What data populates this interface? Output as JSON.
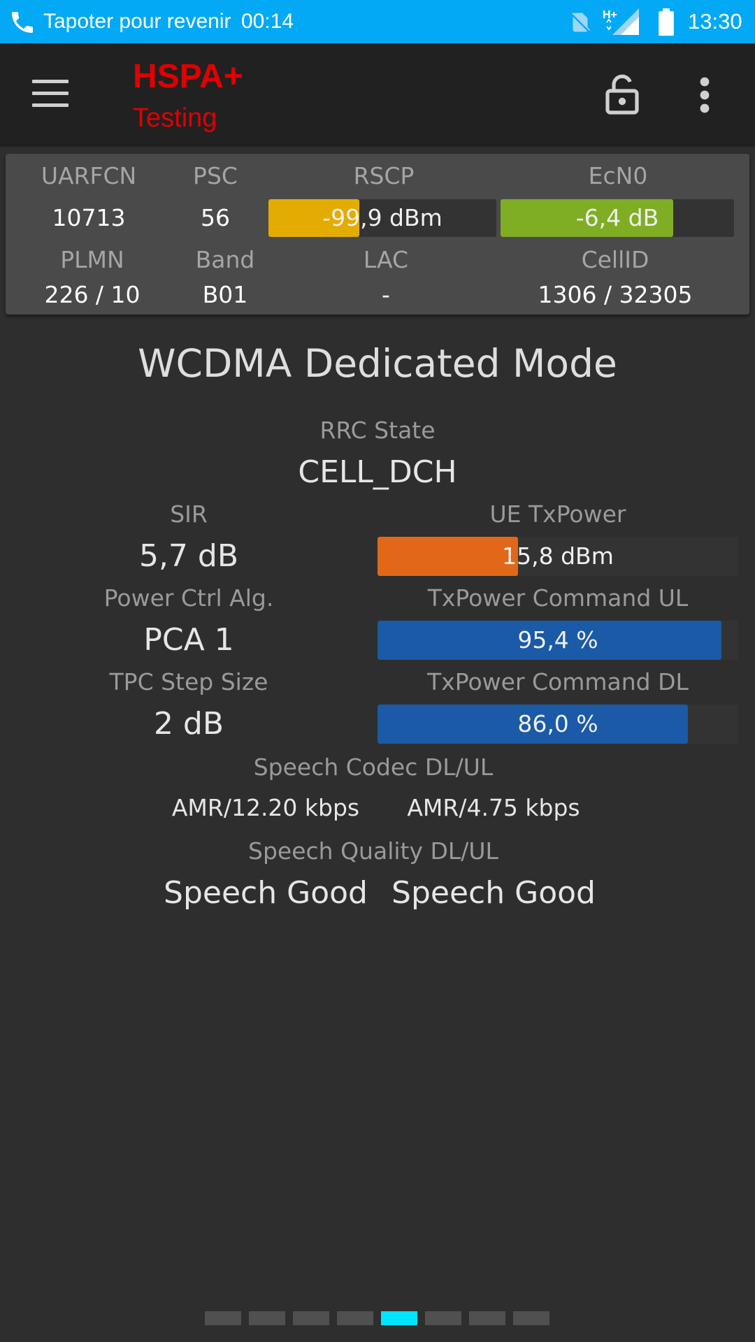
{
  "status_bar": {
    "notification": "Tapoter pour revenir",
    "call_timer": "00:14",
    "network_indicator": "H+",
    "clock": "13:30",
    "icons": [
      "phone-icon",
      "no-sim-icon",
      "signal-icon",
      "battery-icon"
    ]
  },
  "toolbar": {
    "title": "HSPA+",
    "subtitle": "Testing",
    "icons": [
      "menu-icon",
      "lock-icon",
      "more-vert-icon"
    ]
  },
  "panel": {
    "uarfcn": {
      "label": "UARFCN",
      "value": "10713"
    },
    "psc": {
      "label": "PSC",
      "value": "56"
    },
    "rscp": {
      "label": "RSCP",
      "value": "-99,9 dBm",
      "fill": 0.4,
      "color": "#e3ac00"
    },
    "ecn0": {
      "label": "EcN0",
      "value": "-6,4 dB",
      "fill": 0.74,
      "color": "#7fae24"
    },
    "plmn": {
      "label": "PLMN",
      "value": "226 / 10"
    },
    "band": {
      "label": "Band",
      "value": "B01"
    },
    "lac": {
      "label": "LAC",
      "value": "-"
    },
    "cellid": {
      "label": "CellID",
      "value": "1306 / 32305"
    }
  },
  "main": {
    "heading": "WCDMA Dedicated Mode",
    "rrc_state": {
      "label": "RRC State",
      "value": "CELL_DCH"
    },
    "sir": {
      "label": "SIR",
      "value": "5,7 dB"
    },
    "ue_txpower": {
      "label": "UE TxPower",
      "value": "15,8 dBm",
      "fill": 0.39,
      "color": "#e06818"
    },
    "power_ctrl": {
      "label": "Power Ctrl Alg.",
      "value": "PCA 1"
    },
    "txpower_ul": {
      "label": "TxPower Command UL",
      "value": "95,4 %",
      "fill": 0.954,
      "color": "#1a5aa6"
    },
    "tpc_step": {
      "label": "TPC Step Size",
      "value": "2 dB"
    },
    "txpower_dl": {
      "label": "TxPower Command DL",
      "value": "86,0 %",
      "fill": 0.86,
      "color": "#1a5aa6"
    },
    "speech_codec": {
      "label": "Speech Codec DL/UL",
      "dl": "AMR/12.20 kbps",
      "ul": "AMR/4.75 kbps"
    },
    "speech_quality": {
      "label": "Speech Quality DL/UL",
      "dl": "Speech Good",
      "ul": "Speech Good"
    }
  },
  "pager": {
    "count": 8,
    "active_index": 4
  }
}
